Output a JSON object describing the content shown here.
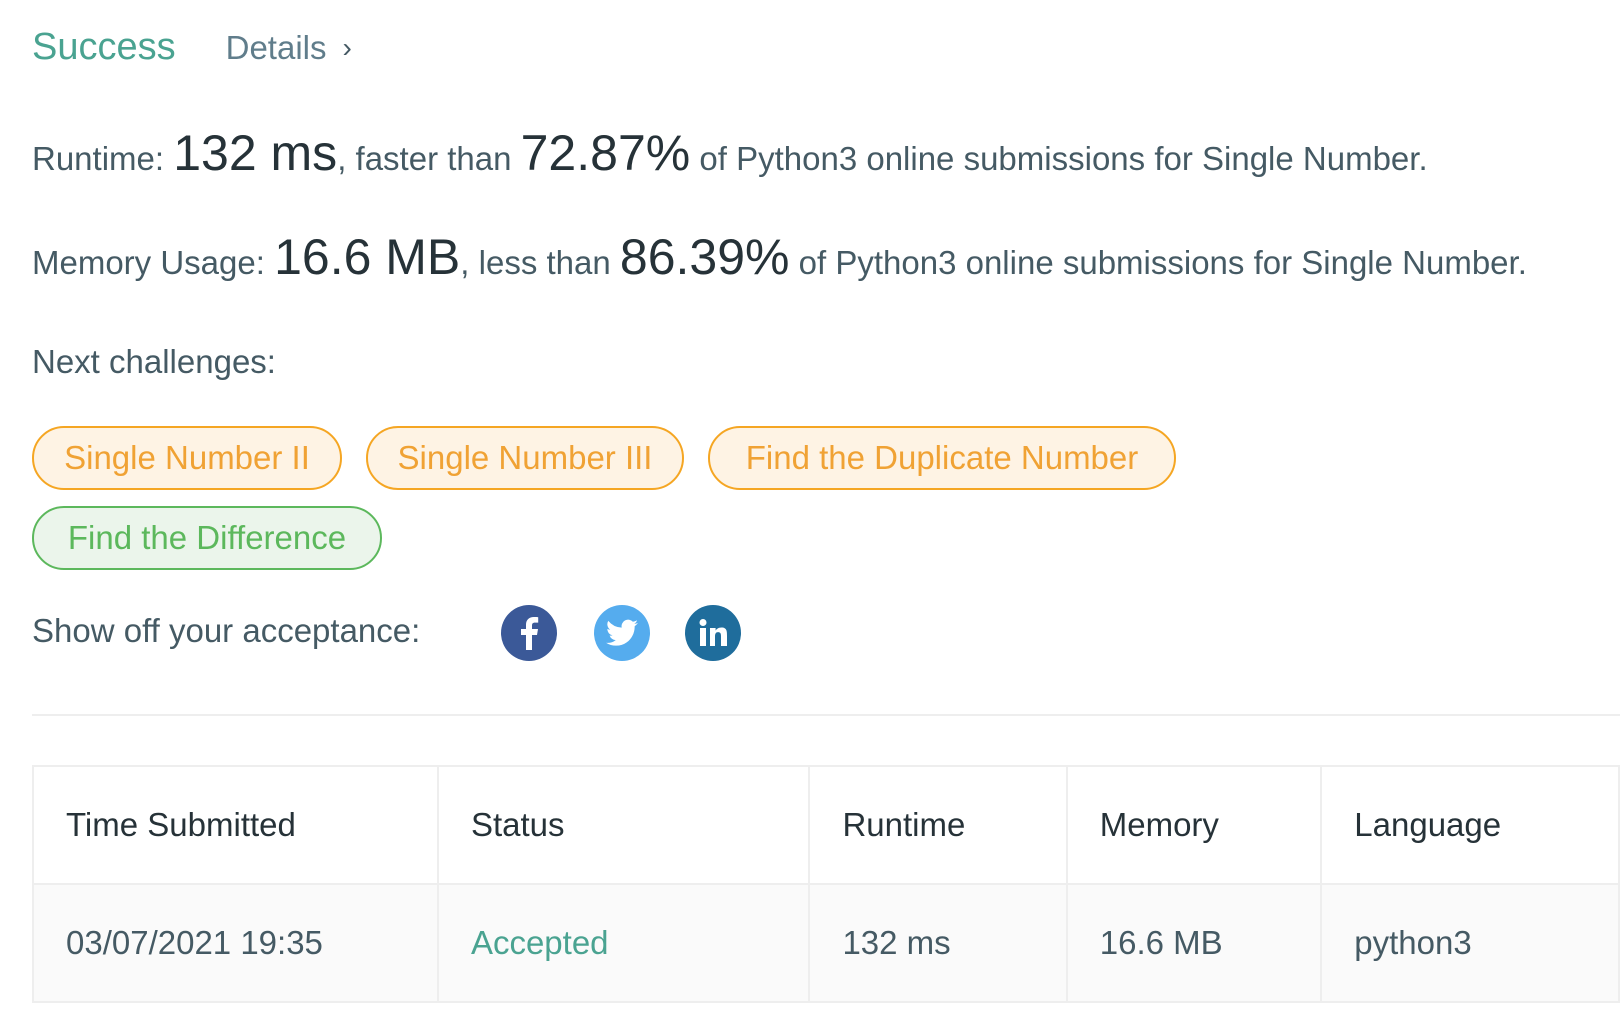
{
  "header": {
    "status": "Success",
    "details_label": "Details",
    "chevron": "›"
  },
  "runtime": {
    "label": "Runtime: ",
    "value": "132 ms",
    "middle": ", faster than ",
    "percent": "72.87%",
    "suffix": " of Python3 online submissions for Single Number."
  },
  "memory": {
    "label": "Memory Usage: ",
    "value": "16.6 MB",
    "middle": ", less than ",
    "percent": "86.39%",
    "suffix": " of Python3 online submissions for Single Number."
  },
  "next": {
    "label": "Next challenges:",
    "challenges": [
      {
        "title": "Single Number II",
        "difficulty": "medium"
      },
      {
        "title": "Single Number III",
        "difficulty": "medium"
      },
      {
        "title": "Find the Duplicate Number",
        "difficulty": "medium"
      },
      {
        "title": "Find the Difference",
        "difficulty": "easy"
      }
    ]
  },
  "share": {
    "label": "Show off your acceptance:",
    "icons": [
      "facebook-icon",
      "twitter-icon",
      "linkedin-icon"
    ]
  },
  "table": {
    "headers": [
      "Time Submitted",
      "Status",
      "Runtime",
      "Memory",
      "Language"
    ],
    "rows": [
      [
        "03/07/2021 19:35",
        "Accepted",
        "132 ms",
        "16.6 MB",
        "python3"
      ]
    ]
  },
  "colors": {
    "success": "#4aa391",
    "medium_border": "#f5a623",
    "easy_border": "#5cb85c",
    "facebook": "#3b5998",
    "twitter": "#55acee",
    "linkedin": "#1f6d9c"
  }
}
